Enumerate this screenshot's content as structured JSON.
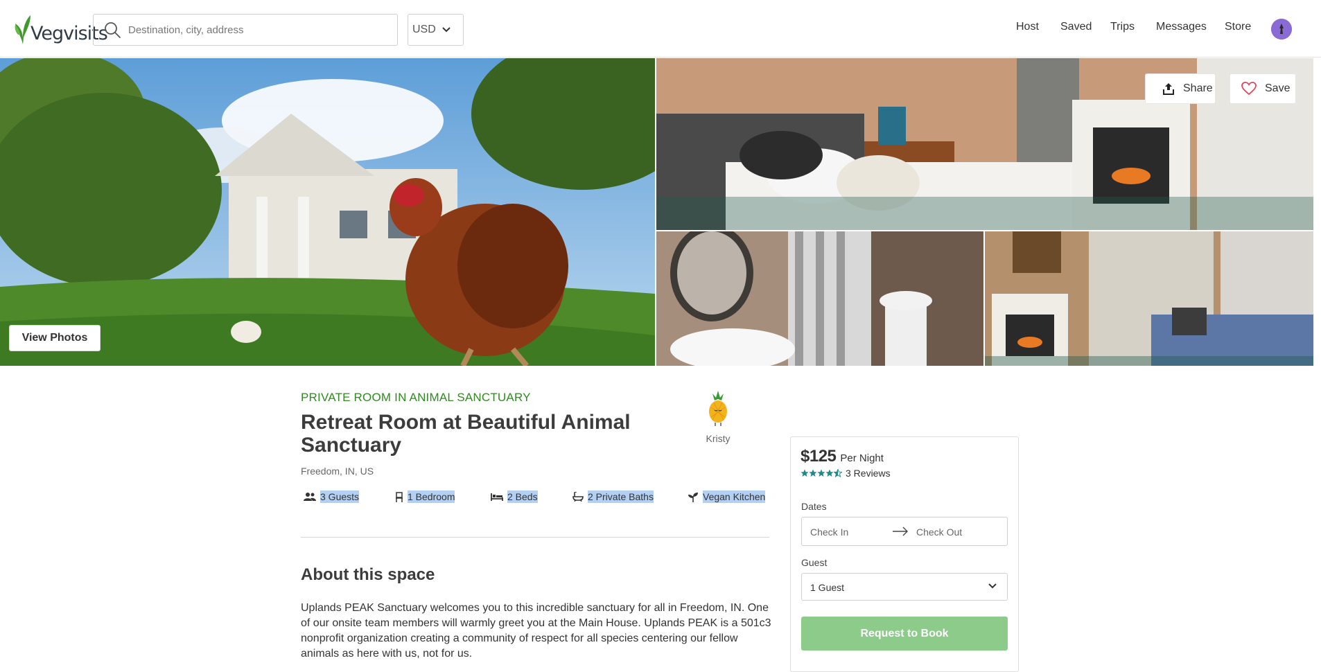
{
  "header": {
    "logo_text": "Vegvisits",
    "search_placeholder": "Destination, city, address",
    "currency": "USD",
    "nav": [
      "Host",
      "Saved",
      "Trips",
      "Messages",
      "Store"
    ]
  },
  "gallery": {
    "view_photos_label": "View Photos",
    "share_label": "Share",
    "save_label": "Save"
  },
  "listing": {
    "category": "PRIVATE ROOM IN ANIMAL SANCTUARY",
    "title": "Retreat Room at Beautiful Animal Sanctuary",
    "location": "Freedom, IN, US",
    "host_name": "Kristy",
    "amenities": [
      {
        "icon": "guests-icon",
        "label": "3 Guests"
      },
      {
        "icon": "chair-icon",
        "label": "1 Bedroom"
      },
      {
        "icon": "bed-icon",
        "label": "2 Beds"
      },
      {
        "icon": "bath-icon",
        "label": "2 Private Baths"
      },
      {
        "icon": "sprout-icon",
        "label": "Vegan Kitchen"
      }
    ],
    "about_heading": "About this space",
    "about_text": "Uplands PEAK Sanctuary welcomes you to this incredible sanctuary for all in Freedom, IN. One of our onsite team members will warmly greet you at the Main House. Uplands PEAK is a 501c3 nonprofit organization creating a community of respect for all species centering our fellow animals as here with us, not for us."
  },
  "booking": {
    "price": "$125",
    "per_night": "Per Night",
    "rating": 4.5,
    "reviews": "3 Reviews",
    "dates_label": "Dates",
    "check_in": "Check In",
    "check_out": "Check Out",
    "guest_label": "Guest",
    "guest_value": "1 Guest",
    "request_label": "Request to Book"
  },
  "colors": {
    "accent_green": "#2f8a1f",
    "button_green": "#8ccb8a",
    "star_teal": "#1f8a8a",
    "selection": "#b3cff2",
    "heart_red": "#e0455b"
  }
}
